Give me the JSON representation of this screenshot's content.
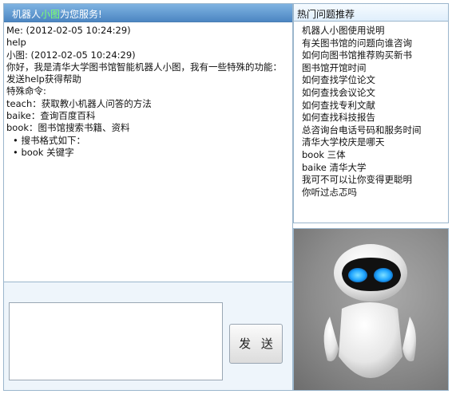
{
  "header": {
    "title_prefix": "机器人",
    "title_highlight": "小图",
    "title_suffix": "为您服务!"
  },
  "chat": {
    "messages": [
      "Me: (2012-02-05 10:24:29)",
      "help",
      "小图: (2012-02-05 10:24:29)",
      "你好，我是清华大学图书馆智能机器人小图，我有一些特殊的功能：",
      "发送help获得帮助",
      "特殊命令:",
      "teach：获取教小机器人问答的方法",
      "baike：查询百度百科",
      "book：图书馆搜索书籍、资料",
      "• 搜书格式如下：",
      "• book 关键字"
    ]
  },
  "compose": {
    "input_value": "",
    "send_label": "发 送"
  },
  "faq": {
    "title": "热门问题推荐",
    "items": [
      "机器人小图使用说明",
      "有关图书馆的问题向谁咨询",
      "如何向图书馆推荐购买新书",
      "图书馆开馆时间",
      "如何查找学位论文",
      "如何查找会议论文",
      "如何查找专利文献",
      "如何查找科技报告",
      "总咨询台电话号码和服务时间",
      "清华大学校庆是哪天",
      "book 三体",
      "baike 清华大学",
      "我可不可以让你变得更聪明",
      "你听过忐忑吗"
    ]
  },
  "colors": {
    "header_blue": "#5a92cc",
    "highlight_green": "#7cff6f",
    "panel_border": "#9bb6cc",
    "compose_bg": "#eef5fb",
    "robot_eye": "#2fb2ff"
  },
  "robot": {
    "icon": "robot-mascot-icon"
  }
}
